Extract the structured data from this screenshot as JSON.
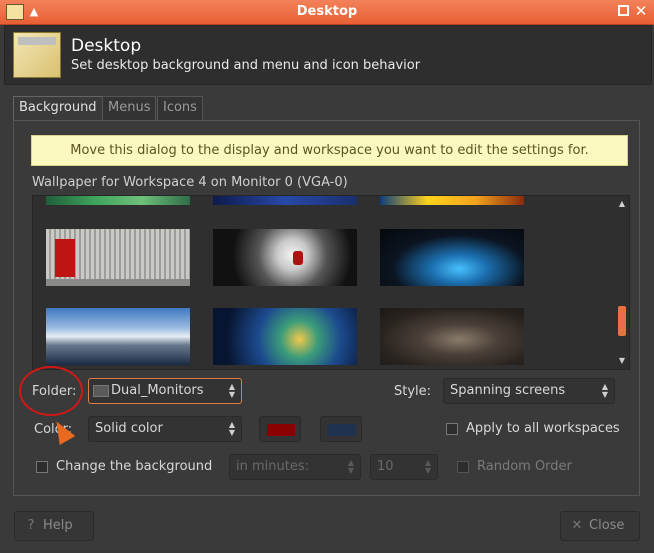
{
  "window": {
    "title": "Desktop"
  },
  "header": {
    "title": "Desktop",
    "subtitle": "Set desktop background and menu and icon behavior",
    "icon": "desktop-settings-icon"
  },
  "tabs": [
    {
      "label": "Background",
      "active": true
    },
    {
      "label": "Menus",
      "active": false
    },
    {
      "label": "Icons",
      "active": false
    }
  ],
  "background": {
    "info_message": "Move this dialog to the display and workspace you want to edit the settings for.",
    "wallpaper_label": "Wallpaper for Workspace 4 on Monitor 0 (VGA-0)",
    "folder_label": "Folder:",
    "folder_value": "Dual_Monitors",
    "style_label": "Style:",
    "style_value": "Spanning screens",
    "color_label": "Color:",
    "color_value": "Solid color",
    "primary_color": "#8b0000",
    "secondary_color": "#1f3350",
    "apply_all_label": "Apply to all workspaces",
    "change_background_label": "Change the background",
    "interval_value": "in minutes:",
    "interval_number": "10",
    "random_order_label": "Random Order"
  },
  "footer": {
    "help_label": "Help",
    "close_label": "Close"
  },
  "accent_color": "#e8643a"
}
